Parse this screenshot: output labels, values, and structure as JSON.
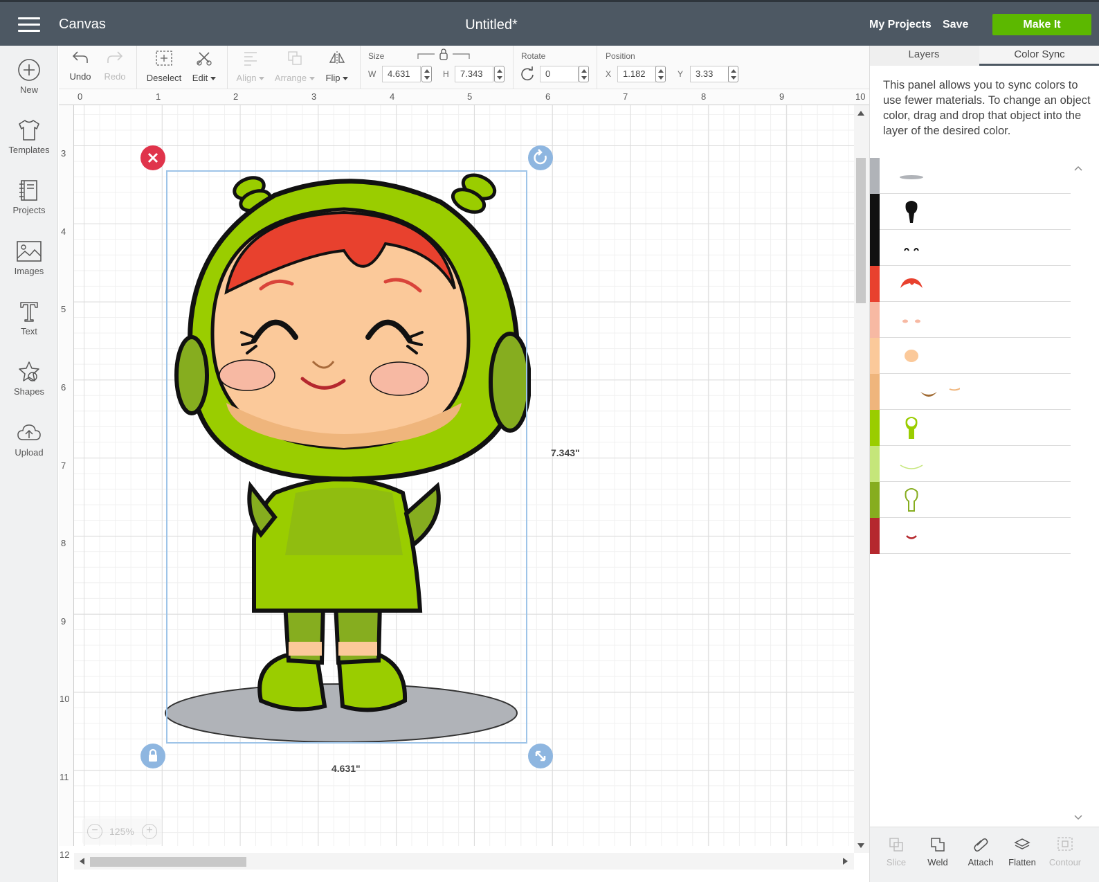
{
  "topbar": {
    "menu_icon": "hamburger-icon",
    "app_title": "Canvas",
    "doc_title": "Untitled*",
    "my_projects": "My Projects",
    "save": "Save",
    "make_it": "Make It",
    "make_it_color": "#5cb800"
  },
  "leftnav": {
    "items": [
      {
        "label": "New",
        "icon": "plus-circle-icon"
      },
      {
        "label": "Templates",
        "icon": "tshirt-icon"
      },
      {
        "label": "Projects",
        "icon": "book-icon"
      },
      {
        "label": "Images",
        "icon": "image-icon"
      },
      {
        "label": "Text",
        "icon": "text-icon"
      },
      {
        "label": "Shapes",
        "icon": "shapes-icon"
      },
      {
        "label": "Upload",
        "icon": "cloud-upload-icon"
      }
    ]
  },
  "toolbar": {
    "undo": "Undo",
    "redo": "Redo",
    "deselect": "Deselect",
    "edit": "Edit",
    "align": "Align",
    "arrange": "Arrange",
    "flip": "Flip",
    "size_label": "Size",
    "w_label": "W",
    "w_value": "4.631",
    "h_label": "H",
    "h_value": "7.343",
    "rotate_label": "Rotate",
    "rotate_value": "0",
    "position_label": "Position",
    "x_label": "X",
    "x_value": "1.182",
    "y_label": "Y",
    "y_value": "3.33"
  },
  "rulers": {
    "horizontal": [
      "0",
      "1",
      "2",
      "3",
      "4",
      "5",
      "6",
      "7",
      "8",
      "9",
      "10"
    ],
    "vertical": [
      "3",
      "4",
      "5",
      "6",
      "7",
      "8",
      "9",
      "10",
      "11",
      "12"
    ]
  },
  "canvas": {
    "width_dim": "4.631\"",
    "height_dim": "7.343\"",
    "zoom_value": "125%",
    "zoom_out": "−",
    "zoom_in": "+"
  },
  "panel": {
    "tabs": [
      "Layers",
      "Color Sync"
    ],
    "active_tab": "Color Sync",
    "description": "This panel allows you to sync colors to use fewer materials. To change an object color, drag and drop that object into the layer of the desired color.",
    "layers": [
      {
        "color": "#b0b3b8",
        "thumb": "shadow-ellipse"
      },
      {
        "color": "#111111",
        "thumb": "black-silhouette"
      },
      {
        "color": "#111111",
        "thumb": "eyes"
      },
      {
        "color": "#e8412e",
        "thumb": "hair"
      },
      {
        "color": "#f7b9a3",
        "thumb": "cheeks"
      },
      {
        "color": "#fbc99a",
        "thumb": "face"
      },
      {
        "color": "#efb57c",
        "thumb": "face-shading"
      },
      {
        "color": "#9acd00",
        "thumb": "suit"
      },
      {
        "color": "#c5e67a",
        "thumb": "suit-highlight"
      },
      {
        "color": "#86ad1f",
        "thumb": "suit-shading"
      },
      {
        "color": "#b5282e",
        "thumb": "mouth"
      }
    ]
  },
  "actions": [
    {
      "label": "Slice",
      "enabled": false,
      "icon": "slice-icon"
    },
    {
      "label": "Weld",
      "enabled": true,
      "icon": "weld-icon"
    },
    {
      "label": "Attach",
      "enabled": true,
      "icon": "attach-icon"
    },
    {
      "label": "Flatten",
      "enabled": true,
      "icon": "flatten-icon"
    },
    {
      "label": "Contour",
      "enabled": false,
      "icon": "contour-icon"
    }
  ]
}
